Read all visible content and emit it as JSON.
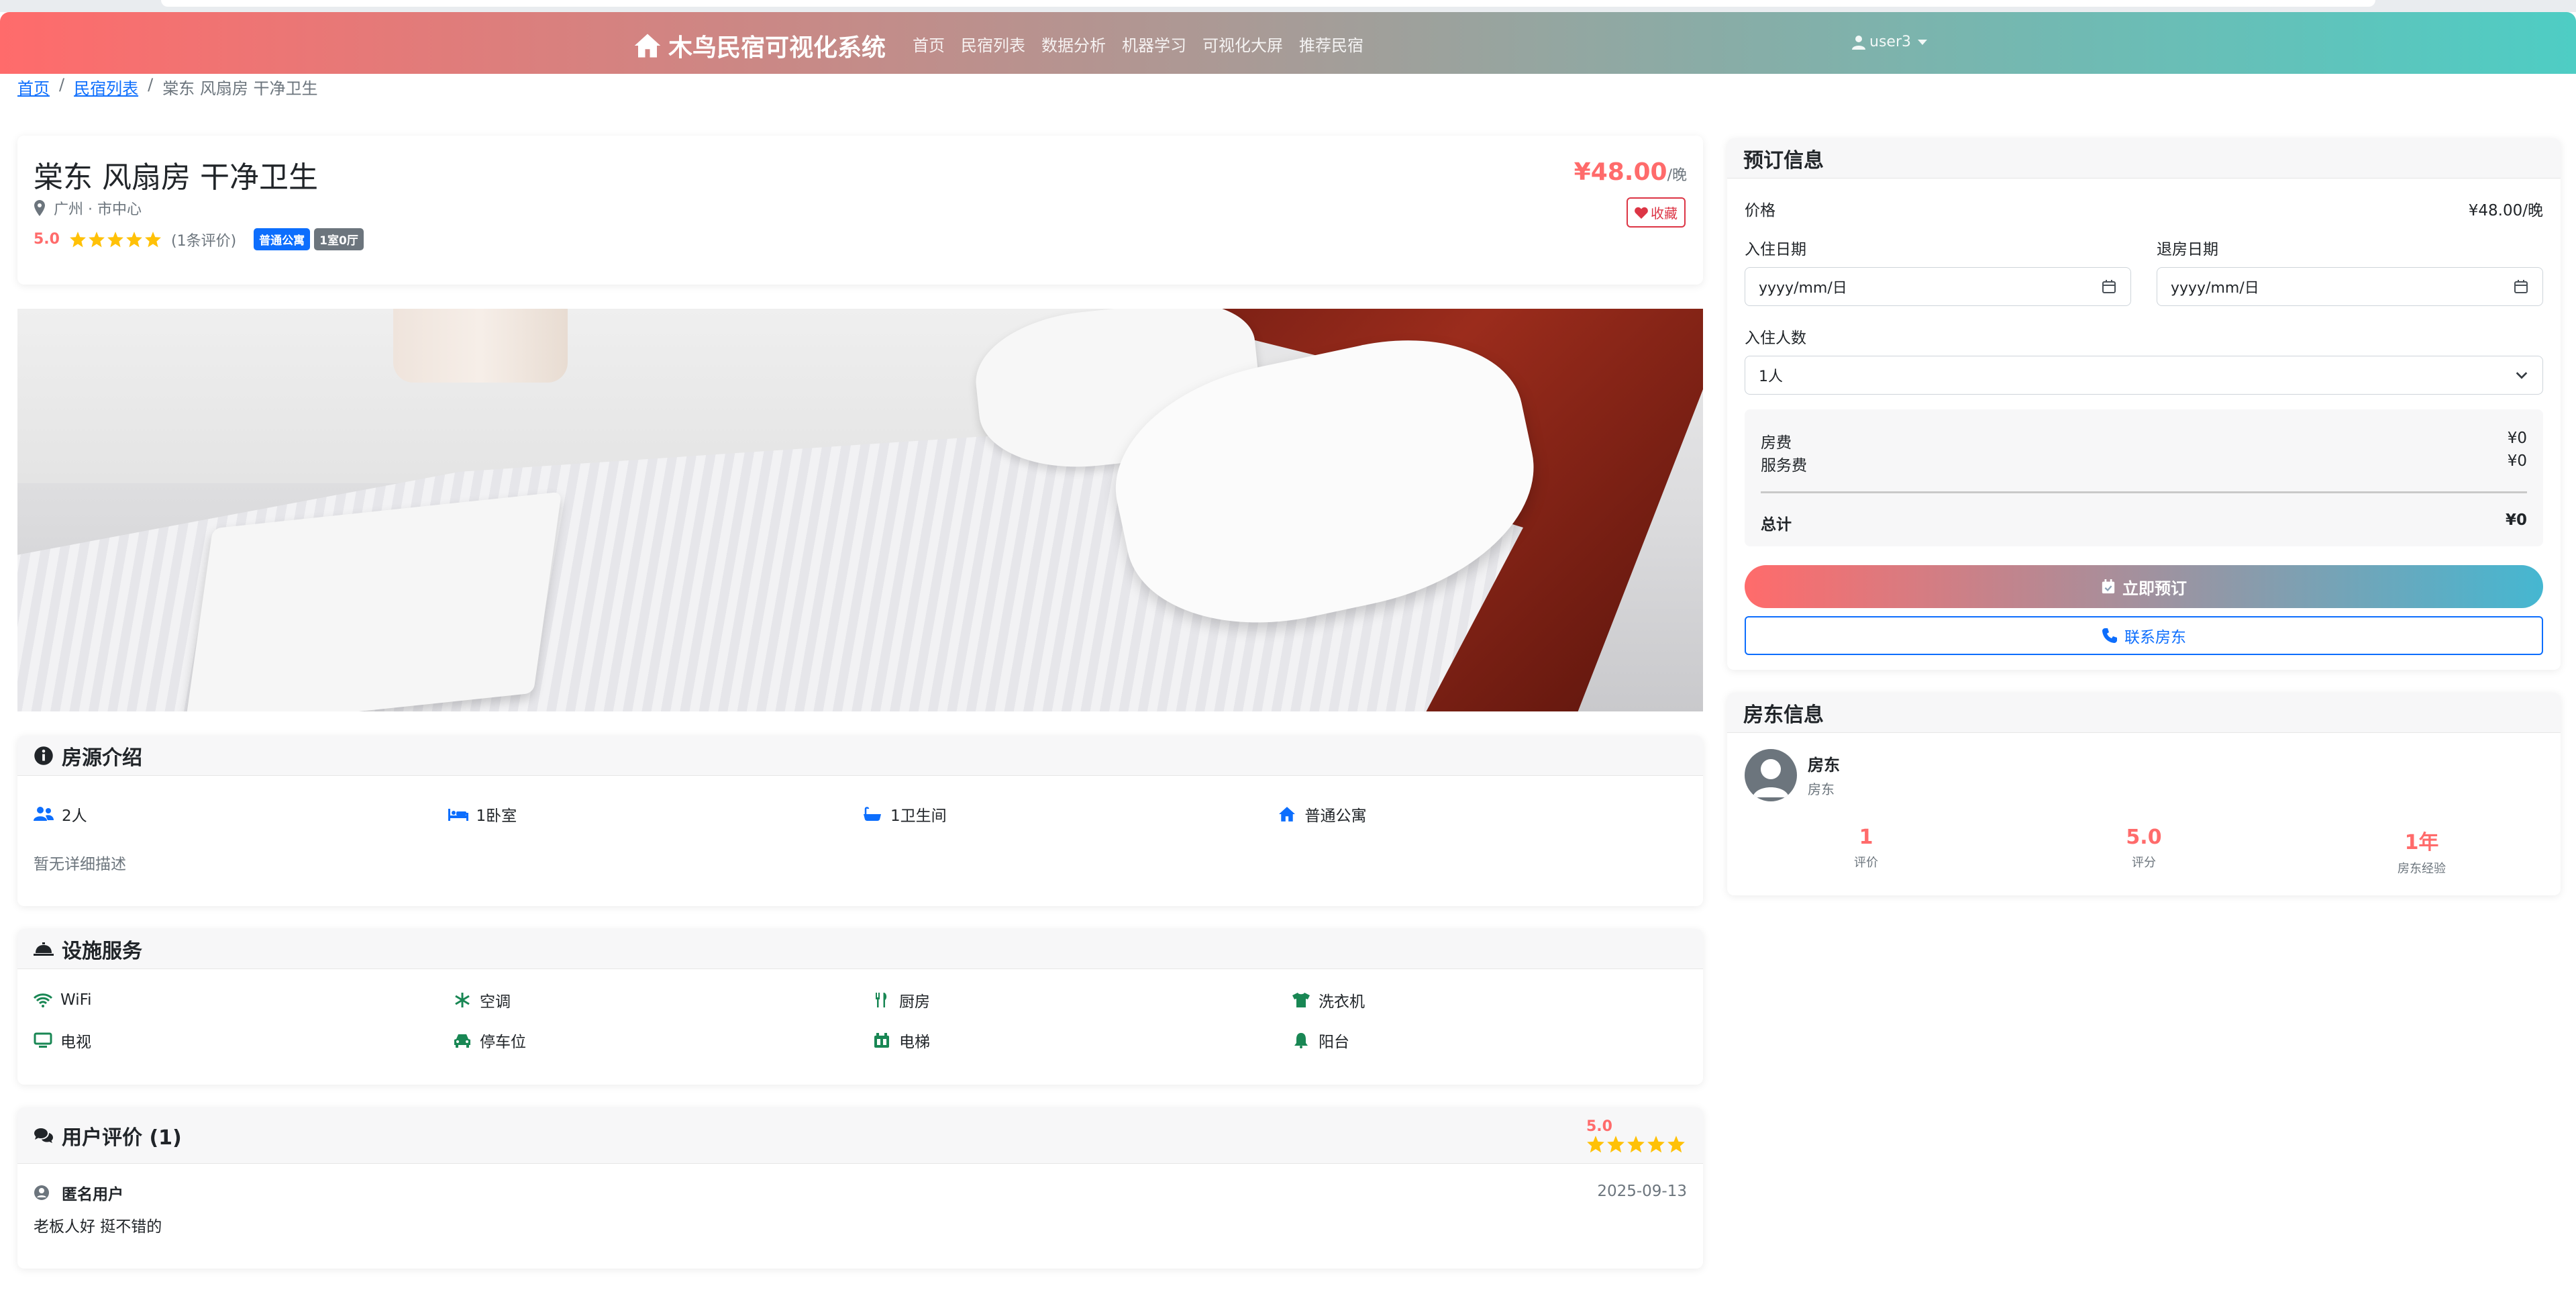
{
  "nav": {
    "brand": "木鸟民宿可视化系统",
    "links": [
      "首页",
      "民宿列表",
      "数据分析",
      "机器学习",
      "可视化大屏",
      "推荐民宿"
    ],
    "user": "user3"
  },
  "breadcrumb": {
    "home": "首页",
    "list": "民宿列表",
    "current": "棠东 风扇房 干净卫生"
  },
  "listing": {
    "title": "棠东 风扇房 干净卫生",
    "location": "广州 · 市中心",
    "score": "5.0",
    "star_rating": 5,
    "review_count": "(1条评价)",
    "badges": [
      "普通公寓",
      "1室0厅"
    ],
    "price": "¥48.00",
    "price_unit": "/晚",
    "favorite_label": "收藏"
  },
  "intro": {
    "header": "房源介绍",
    "features": [
      {
        "icon": "users-icon",
        "label": "2人"
      },
      {
        "icon": "bed-icon",
        "label": "1卧室"
      },
      {
        "icon": "bath-icon",
        "label": "1卫生间"
      },
      {
        "icon": "home-icon",
        "label": "普通公寓"
      }
    ],
    "description": "暂无详细描述"
  },
  "facilities": {
    "header": "设施服务",
    "items": [
      {
        "icon": "wifi-icon",
        "label": "WiFi"
      },
      {
        "icon": "snowflake-icon",
        "label": "空调"
      },
      {
        "icon": "utensils-icon",
        "label": "厨房"
      },
      {
        "icon": "shirt-icon",
        "label": "洗衣机"
      },
      {
        "icon": "tv-icon",
        "label": "电视"
      },
      {
        "icon": "car-icon",
        "label": "停车位"
      },
      {
        "icon": "elevator-icon",
        "label": "电梯"
      },
      {
        "icon": "bell-icon",
        "label": "阳台"
      }
    ]
  },
  "reviews": {
    "header": "用户评价 (1)",
    "score": "5.0",
    "star_rating": 5,
    "items": [
      {
        "user": "匿名用户",
        "date": "2025-09-13",
        "text": "老板人好 挺不错的"
      }
    ]
  },
  "booking": {
    "header": "预订信息",
    "price_label": "价格",
    "price_value": "¥48.00/晚",
    "checkin_label": "入住日期",
    "checkin_placeholder": "yyyy/mm/日",
    "checkout_label": "退房日期",
    "checkout_placeholder": "yyyy/mm/日",
    "guests_label": "入住人数",
    "guests_value": "1人",
    "room_fee_label": "房费",
    "room_fee_value": "¥0",
    "service_fee_label": "服务费",
    "service_fee_value": "¥0",
    "total_label": "总计",
    "total_value": "¥0",
    "book_button": "立即预订",
    "contact_button": "联系房东"
  },
  "host": {
    "header": "房东信息",
    "name": "房东",
    "role": "房东",
    "stats": [
      {
        "value": "1",
        "label": "评价"
      },
      {
        "value": "5.0",
        "label": "评分"
      },
      {
        "value": "1年",
        "label": "房东经验"
      }
    ]
  },
  "colors": {
    "accent": "#ff6b6b",
    "primary": "#0d6efd",
    "facility_icon": "#198754",
    "star": "#ffc107"
  }
}
